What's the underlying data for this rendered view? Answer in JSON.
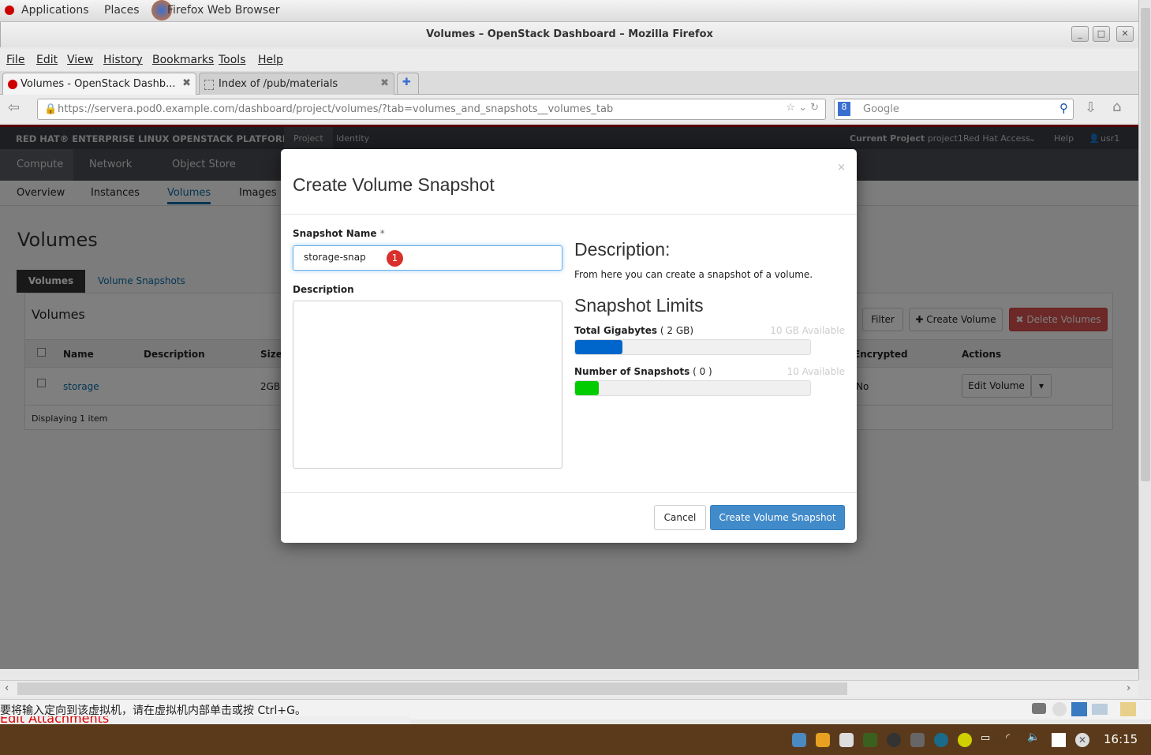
{
  "desktop": {
    "applications": "Applications",
    "places": "Places",
    "active_app": "Firefox Web Browser",
    "clock": "16:15",
    "status_message": "要将输入定向到该虚拟机，请在虚拟机内部单击或按 Ctrl+G。",
    "bg_text": "Edit Attachments"
  },
  "browser": {
    "title": "Volumes – OpenStack Dashboard – Mozilla Firefox",
    "menu": [
      "File",
      "Edit",
      "View",
      "History",
      "Bookmarks",
      "Tools",
      "Help"
    ],
    "tabs": [
      {
        "label": "Volumes - OpenStack Dashb..."
      },
      {
        "label": "Index of /pub/materials"
      }
    ],
    "url": "https://servera.pod0.example.com/dashboard/project/volumes/?tab=volumes_and_snapshots__volumes_tab",
    "search_placeholder": "Google"
  },
  "dashboard": {
    "brand": "RED HAT® ENTERPRISE LINUX OPENSTACK PLATFORM",
    "top_tabs": [
      "Project",
      "Identity"
    ],
    "current_project_label": "Current Project",
    "current_project": "project1",
    "red_hat_access": "Red Hat Access",
    "help": "Help",
    "user": "usr1",
    "subnav": [
      "Compute",
      "Network",
      "Object Store"
    ],
    "tertnav": [
      "Overview",
      "Instances",
      "Volumes",
      "Images"
    ],
    "page_title": "Volumes",
    "content_tabs": [
      "Volumes",
      "Volume Snapshots"
    ],
    "table_title": "Volumes",
    "buttons": {
      "filter": "Filter",
      "create": "Create Volume",
      "delete": "Delete Volumes"
    },
    "columns": [
      "Name",
      "Description",
      "Size",
      "Encrypted",
      "Actions"
    ],
    "rows": [
      {
        "name": "storage",
        "description": "",
        "size": "2GB",
        "encrypted": "No",
        "action": "Edit Volume"
      }
    ],
    "footer": "Displaying 1 item"
  },
  "modal": {
    "title": "Create Volume Snapshot",
    "name_label": "Snapshot Name",
    "required_mark": "*",
    "name_value": "storage-snap",
    "badge": "1",
    "description_label": "Description",
    "description_value": "",
    "help_title": "Description:",
    "help_text": "From here you can create a snapshot of a volume.",
    "limits_title": "Snapshot Limits",
    "limits": [
      {
        "label": "Total Gigabytes",
        "used": "( 2 GB)",
        "available": "10 GB Available",
        "percent": 20,
        "color": "#0066cc"
      },
      {
        "label": "Number of Snapshots",
        "used": "( 0 )",
        "available": "10 Available",
        "percent": 10,
        "color": "#00cc00"
      }
    ],
    "cancel": "Cancel",
    "submit": "Create Volume Snapshot"
  }
}
